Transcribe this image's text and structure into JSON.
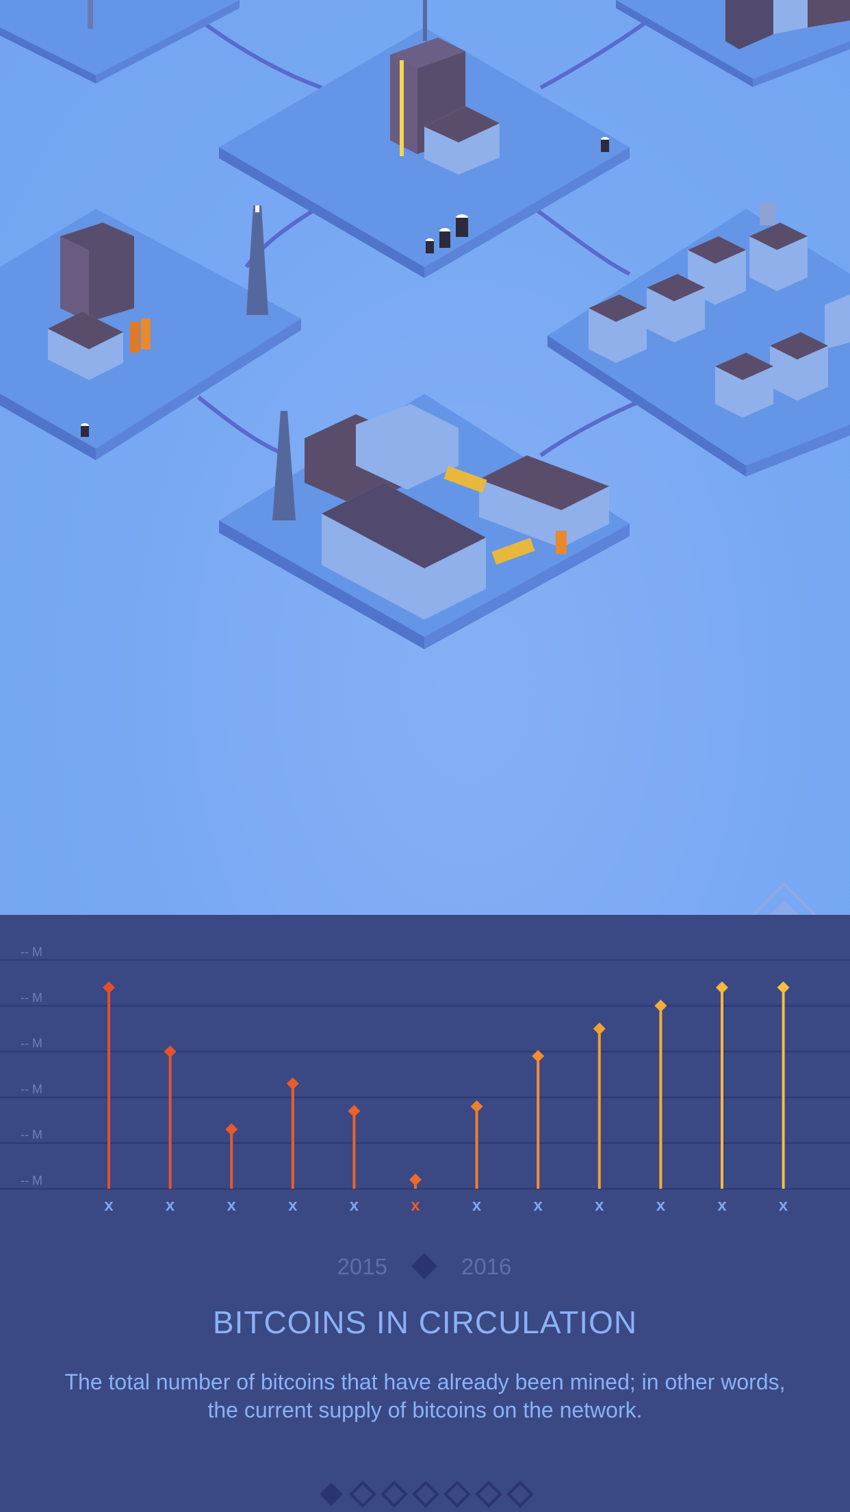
{
  "title": "BITCOINS IN CIRCULATION",
  "description": "The total number of bitcoins that have already been mined; in other words, the current supply of bitcoins on the network.",
  "years": {
    "left": "2015",
    "right": "2016"
  },
  "pager": {
    "count": 7,
    "active_index": 0
  },
  "colors": {
    "panel": "#3a4884",
    "scene_bg": "#78a8f3",
    "accent_text": "#8ab2f5",
    "active_label": "#ee5a2c",
    "gridline": "#2c3873"
  },
  "chart_data": {
    "type": "bar",
    "style": "lollipop",
    "y_tick_labels": [
      "-- M",
      "-- M",
      "-- M",
      "-- M",
      "-- M",
      "-- M"
    ],
    "categories": [
      "x",
      "x",
      "x",
      "x",
      "x",
      "x",
      "x",
      "x",
      "x",
      "x",
      "x",
      "x"
    ],
    "values": [
      4.4,
      3.0,
      1.3,
      2.3,
      1.7,
      0.2,
      1.8,
      2.9,
      3.5,
      4.0,
      4.4,
      4.4
    ],
    "ylim": [
      0,
      5
    ],
    "selected_index": 5,
    "colors": [
      "#e34f2d",
      "#e5532d",
      "#e8582b",
      "#ea5d2a",
      "#ec622a",
      "#ee6a29",
      "#f07f2b",
      "#f28e2e",
      "#f3a032",
      "#f4ad38",
      "#f5b83c",
      "#f6be40"
    ],
    "grid": true
  }
}
